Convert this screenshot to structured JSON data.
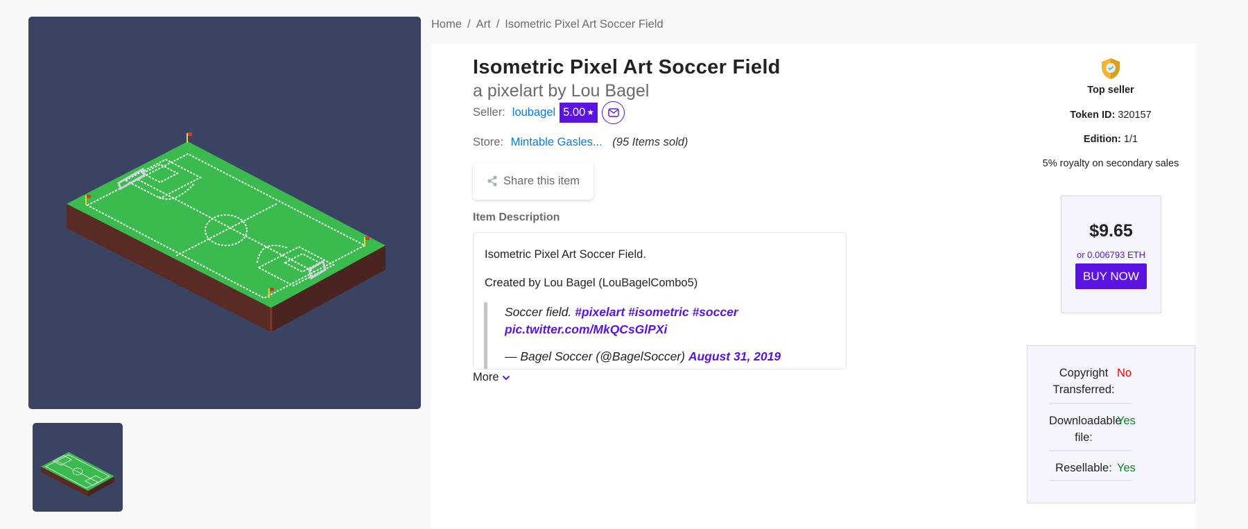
{
  "breadcrumb": [
    {
      "label": "Home"
    },
    {
      "label": "Art"
    },
    {
      "label": "Isometric Pixel Art Soccer Field"
    }
  ],
  "breadcrumb_separator": "/",
  "item": {
    "title": "Isometric Pixel Art Soccer Field",
    "subtitle": "a pixelart by Lou Bagel",
    "image_alt": "Isometric pixel art soccer field on navy background"
  },
  "seller": {
    "label": "Seller:",
    "name": "loubagel",
    "rating": "5.00",
    "rating_icon": "star-icon",
    "contact_icon": "envelope-icon"
  },
  "store": {
    "label": "Store:",
    "name": "Mintable Gasles...",
    "items_sold": "(95 Items sold)"
  },
  "share": {
    "label": "Share this item",
    "icon": "share-icon"
  },
  "description": {
    "heading": "Item Description",
    "paragraphs": [
      "Isometric Pixel Art Soccer Field.",
      "Created by Lou Bagel (LouBagelCombo5)"
    ],
    "quote": {
      "text": "Soccer field.",
      "hashtags": [
        "#pixelart",
        "#isometric",
        "#soccer"
      ],
      "pic_link": "pic.twitter.com/MkQCsGlPXi",
      "attribution": "— Bagel Soccer (@BagelSoccer)",
      "date_link": "August 31, 2019"
    },
    "more_label": "More"
  },
  "sidebar": {
    "badge_icon": "shield-check-icon",
    "badge_label": "Top seller",
    "token_label": "Token ID:",
    "token_value": "320157",
    "edition_label": "Edition:",
    "edition_value": "1/1",
    "royalty": "5% royalty on secondary sales"
  },
  "purchase": {
    "price": "$9.65",
    "eth": "or 0.006793 ETH",
    "buy_label": "BUY NOW"
  },
  "rights": [
    {
      "label": "Copyright Transferred:",
      "value": "No",
      "status": "negative"
    },
    {
      "label": "Downloadable file:",
      "value": "Yes",
      "status": "positive"
    },
    {
      "label": "Resellable:",
      "value": "Yes",
      "status": "positive"
    }
  ],
  "colors": {
    "accent": "#5b14e0",
    "link": "#0a7be0",
    "image_bg": "#3a4462",
    "negative": "#ee0000",
    "positive": "#0a8a1e"
  }
}
